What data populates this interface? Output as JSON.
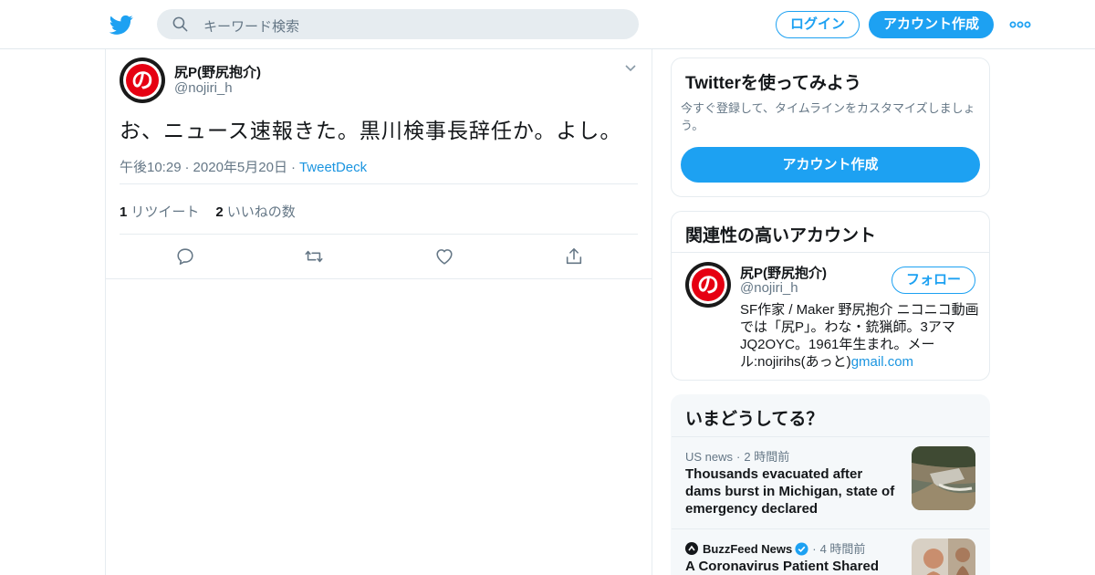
{
  "colors": {
    "accent": "#1da1f2",
    "link": "#1b95e0",
    "muted": "#657786",
    "text": "#14171a",
    "border": "#e6ecf0",
    "avatar_red": "#e60012"
  },
  "topbar": {
    "logo_icon": "twitter-bird-icon",
    "search_icon": "search-icon",
    "search_placeholder": "キーワード検索",
    "login_label": "ログイン",
    "signup_label": "アカウント作成",
    "more_icon": "more-dots-icon"
  },
  "tweet": {
    "author_name": "尻P(野尻抱介)",
    "author_handle": "@nojiri_h",
    "avatar_glyph": "の",
    "menu_icon": "chevron-down-icon",
    "text": "お、ニュース速報きた。黒川検事長辞任か。よし。",
    "time": "午後10:29",
    "date": "2020年5月20日",
    "source": "TweetDeck",
    "retweet_count": "1",
    "retweet_label": "リツイート",
    "like_count": "2",
    "like_label": "いいねの数",
    "actions": [
      "reply-icon",
      "retweet-icon",
      "like-icon",
      "share-icon"
    ]
  },
  "signup_card": {
    "title": "Twitterを使ってみよう",
    "description": "今すぐ登録して、タイムラインをカスタマイズしましょう。",
    "button_label": "アカウント作成"
  },
  "related_card": {
    "title": "関連性の高いアカウント",
    "name": "尻P(野尻抱介)",
    "handle": "@nojiri_h",
    "follow_label": "フォロー",
    "bio_text": "SF作家 / Maker 野尻抱介 ニコニコ動画では「尻P」。わな・銃猟師。3アマJQ2OYC。1961年生まれ。メール:nojirihs(あっと)",
    "bio_link": "gmail.com"
  },
  "trends_card": {
    "title": "いまどうしてる？",
    "items": [
      {
        "source": "US news",
        "time": "2 時間前",
        "headline": "Thousands evacuated after dams burst in Michigan, state of emergency declared"
      },
      {
        "source": "BuzzFeed News",
        "verified_icon": "verified-badge-icon",
        "time": "4 時間前",
        "headline": "A Coronavirus Patient Shared"
      }
    ]
  }
}
